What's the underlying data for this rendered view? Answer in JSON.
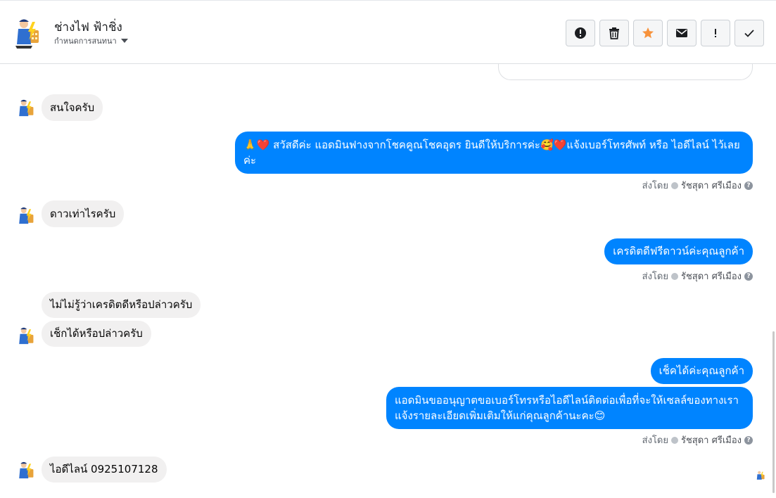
{
  "header": {
    "contact_name": "ช่างไฟ ฟ้าชิ่ง",
    "subtitle": "กำหนดการสนทนา",
    "actions": [
      {
        "name": "spam-button",
        "icon": "alert-circle-icon"
      },
      {
        "name": "delete-button",
        "icon": "trash-icon"
      },
      {
        "name": "star-button",
        "icon": "star-icon"
      },
      {
        "name": "mark-unread-button",
        "icon": "envelope-icon"
      },
      {
        "name": "important-button",
        "icon": "exclamation-icon"
      },
      {
        "name": "mark-done-button",
        "icon": "check-icon"
      }
    ]
  },
  "colors": {
    "outgoing_bubble": "#0084ff",
    "incoming_bubble": "#f1f0f0",
    "star": "#f7923b"
  },
  "messages": {
    "m1": "สนใจครับ",
    "m2_line1": "🙏❤️ สวัสดีค่ะ แอดมินฟางจากโชคคูณโชคอุดร ยินดีให้บริการค่ะ🥰❤️แจ้งเบอร์โทรศัพท์ หรือ ไอดีไลน์  ไว้เลย",
    "m2_line2": "ค่ะ",
    "m3": "ดาวเท่าไรครับ",
    "m4": "เครดิตดีฟรีดาวน์ค่ะคุณลูกค้า",
    "m5": "ไม่ไม่รู้ว่าเครดิตดีหรือปล่าวครับ",
    "m6": "เช็กได้หรือปล่าวครับ",
    "m7": "เช็คได้ค่ะคุณลูกค้า",
    "m8_line1": "แอดมินขออนุญาตขอเบอร์โทรหรือไอดีไลน์ติดต่อเพื่อที่จะให้เซลล์ของทางเรา",
    "m8_line2": "แจ้งรายละเอียดเพิ่มเติมให้แก่คุณลูกค้านะคะ😊",
    "m9": "ไอดีไลน์ 0925107128"
  },
  "sent_by": {
    "label": "ส่งโดย",
    "agent": "รัชสุดา ศรีเมือง",
    "help": "?"
  }
}
